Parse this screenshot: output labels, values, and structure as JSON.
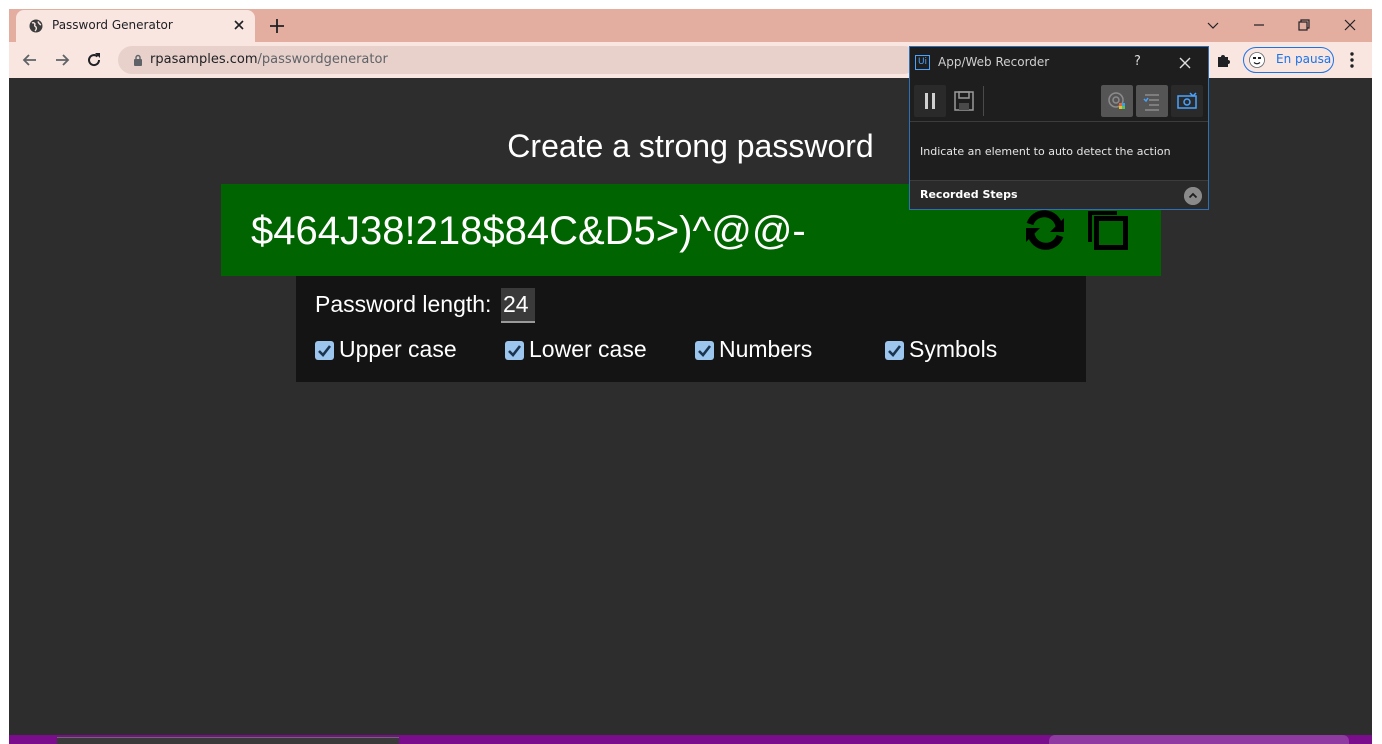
{
  "browser": {
    "tab_title": "Password Generator",
    "url_host": "rpasamples.com",
    "url_path": "/passwordgenerator",
    "profile_label": "En pausa"
  },
  "page": {
    "title": "Create a strong password",
    "password": "$464J38!218$84C&D5>)^@@-",
    "length_label": "Password length:",
    "length_value": "24",
    "options": [
      {
        "label": "Upper case",
        "checked": true
      },
      {
        "label": "Lower case",
        "checked": true
      },
      {
        "label": "Numbers",
        "checked": true
      },
      {
        "label": "Symbols",
        "checked": true
      }
    ]
  },
  "recorder": {
    "logo": "Ui",
    "title": "App/Web Recorder",
    "help": "?",
    "message": "Indicate an element to auto detect the action",
    "steps_label": "Recorded Steps"
  },
  "colors": {
    "tabstrip": "#e3ada0",
    "toolbar": "#f9e6e1",
    "page_bg": "#2d2d2d",
    "password_bg": "#006400",
    "options_bg": "#141414",
    "checkbox": "#9cc6ee",
    "recorder_border": "#2f6fb8"
  }
}
